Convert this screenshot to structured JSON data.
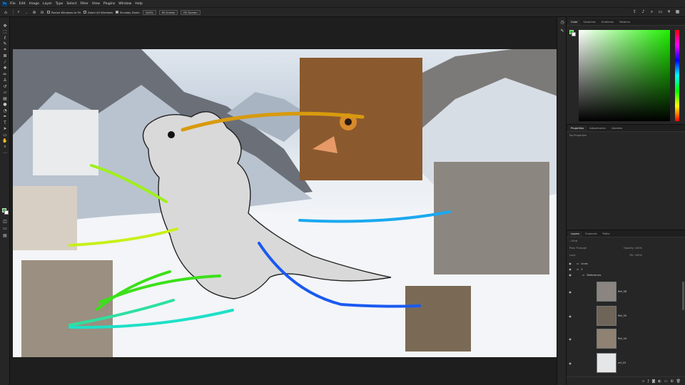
{
  "app": {
    "logo": "Ps"
  },
  "menu": [
    "File",
    "Edit",
    "Image",
    "Layer",
    "Type",
    "Select",
    "Filter",
    "View",
    "Plugins",
    "Window",
    "Help"
  ],
  "options_bar": {
    "resize_windows_label": "Resize Windows to Fit",
    "zoom_all_label": "Zoom All Windows",
    "scrubby_zoom_label": "Scrubby Zoom",
    "zoom_value": "100%",
    "fit_screen_label": "Fit Screen",
    "fill_screen_label": "Fill Screen"
  },
  "color_panel": {
    "tabs": [
      "Color",
      "Swatches",
      "Gradients",
      "Patterns"
    ],
    "foreground": "#22c11f",
    "background": "#ffffff"
  },
  "properties_panel": {
    "tabs": [
      "Properties",
      "Adjustments",
      "Libraries"
    ],
    "empty_text": "No Properties"
  },
  "layers_panel": {
    "tabs": [
      "Layers",
      "Channels",
      "Paths"
    ],
    "kind_label": "Kind",
    "blend_mode": "Pass Through",
    "opacity_label": "Opacity:",
    "opacity_value": "100%",
    "lock_label": "Lock:",
    "fill_label": "Fill:",
    "fill_value": "100%",
    "layers": [
      {
        "name": "Lines",
        "type": "folder"
      },
      {
        "name": "2",
        "type": "folder"
      },
      {
        "name": "References",
        "type": "folder"
      },
      {
        "name": "Ref_06",
        "type": "image"
      },
      {
        "name": "Ref_05",
        "type": "image"
      },
      {
        "name": "Ref_04",
        "type": "image"
      },
      {
        "name": "ref_03",
        "type": "image"
      }
    ]
  },
  "icons": {
    "tools": [
      "move-icon",
      "marquee-icon",
      "lasso-icon",
      "quick-select-icon",
      "crop-icon",
      "frame-icon",
      "eyedropper-icon",
      "healing-icon",
      "brush-icon",
      "stamp-icon",
      "history-brush-icon",
      "eraser-icon",
      "gradient-icon",
      "blur-icon",
      "dodge-icon",
      "pen-icon",
      "type-icon",
      "path-select-icon",
      "shape-icon",
      "hand-icon",
      "zoom-icon",
      "more-tools-icon"
    ]
  }
}
